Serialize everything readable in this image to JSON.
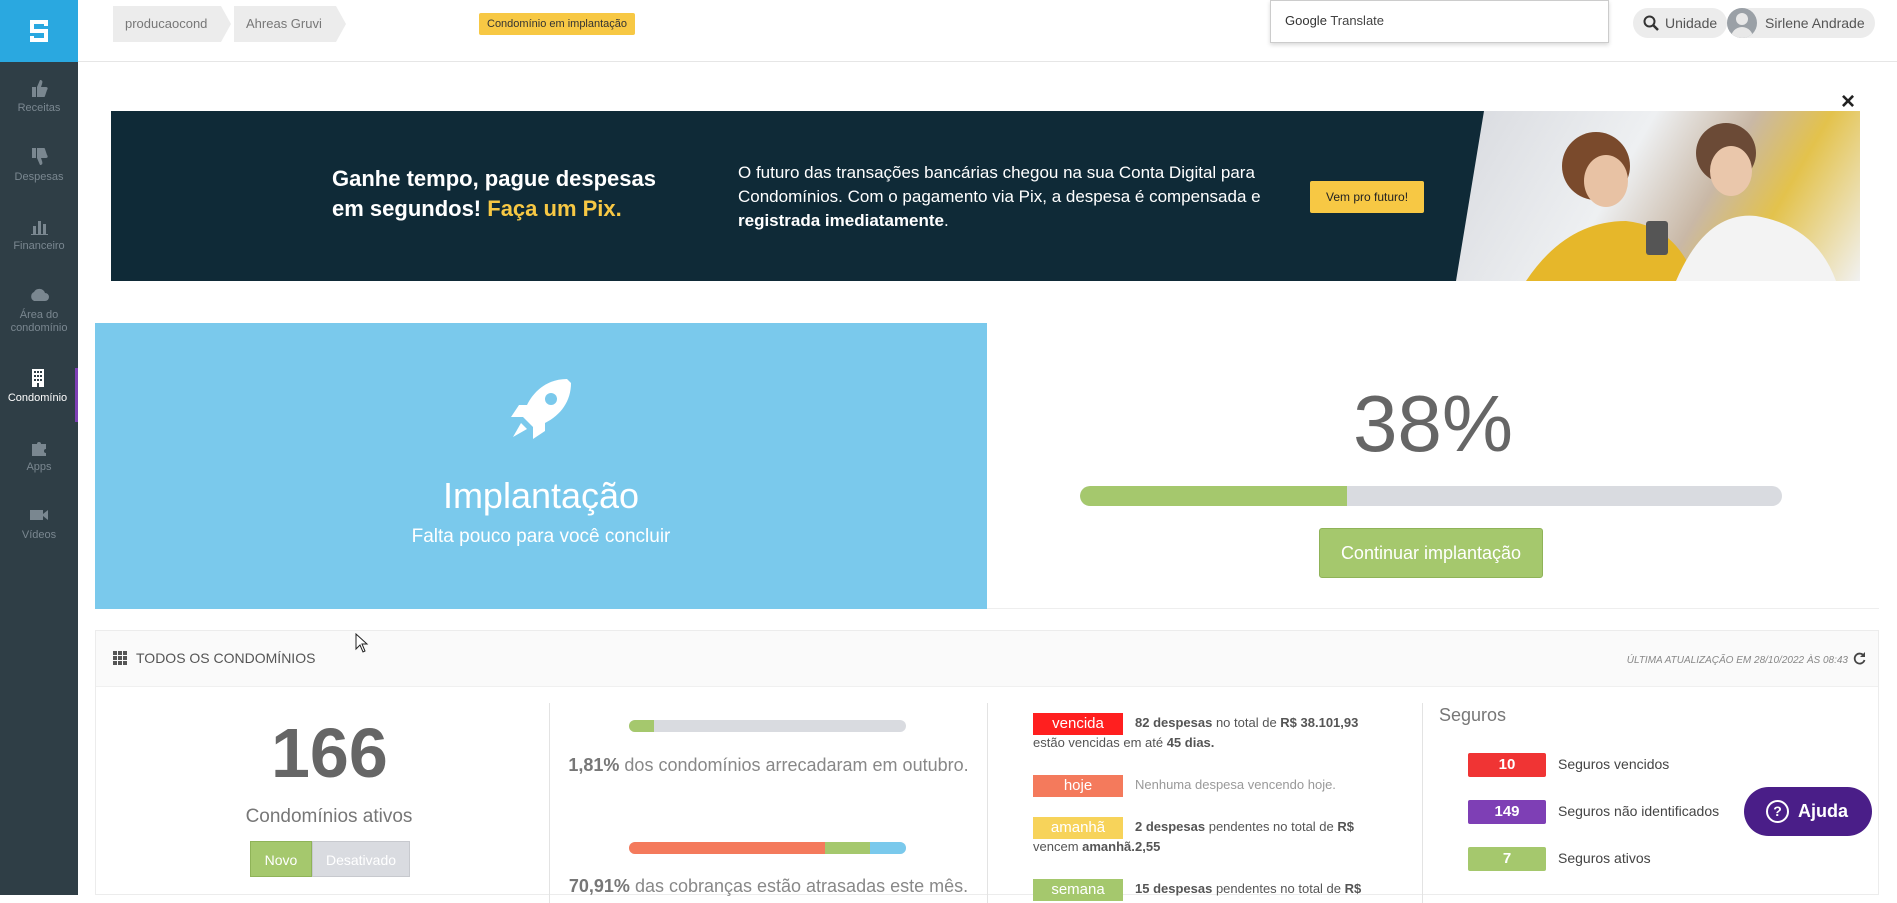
{
  "sidebar": {
    "items": [
      {
        "label": "Receitas",
        "icon": "thumbs-up-icon"
      },
      {
        "label": "Despesas",
        "icon": "thumbs-down-icon"
      },
      {
        "label": "Financeiro",
        "icon": "bar-chart-icon"
      },
      {
        "label": "Área do condomínio",
        "icon": "cloud-icon"
      },
      {
        "label": "Condomínio",
        "icon": "building-icon",
        "active": true
      },
      {
        "label": "Apps",
        "icon": "puzzle-icon"
      },
      {
        "label": "Vídeos",
        "icon": "video-camera-icon"
      }
    ]
  },
  "header": {
    "breadcrumbs": [
      "producaocond",
      "Ahreas Gruvi"
    ],
    "status_badge": "Condomínio em implantação",
    "google_translate": {
      "brand": "Google",
      "label": "Translate"
    },
    "search_label": "Unidade",
    "user_name": "Sirlene Andrade"
  },
  "banner": {
    "headline_part1": "Ganhe tempo, pague despesas em segundos! ",
    "headline_highlight": "Faça um Pix.",
    "body_part1": "O futuro das transações bancárias chegou na sua Conta Digital para Condomínios. Com o pagamento via Pix, a despesa é compensada e ",
    "body_bold": "registrada imediatamente",
    "body_end": ".",
    "cta": "Vem pro futuro!",
    "close_icon": "×"
  },
  "implantacao": {
    "title": "Implantação",
    "subtitle": "Falta pouco para você concluir",
    "percent_label": "38%",
    "progress_fraction": 0.38,
    "continue_button": "Continuar implantação"
  },
  "condominios": {
    "title": "TODOS OS CONDOMÍNIOS",
    "last_update": "ÚLTIMA ATUALIZAÇÃO EM 28/10/2022 ÀS 08:43",
    "active_count": "166",
    "active_label": "Condomínios ativos",
    "filter_new": "Novo",
    "filter_disabled": "Desativado",
    "collected_pct": "1,81%",
    "collected_text": " dos condomínios arrecadaram em outubro.",
    "collected_fraction": 0.0181,
    "late_pct": "70,91%",
    "late_text": " das cobranças estão atrasadas este mês.",
    "late_bar_segments": [
      0.7091,
      0.16,
      0.1309
    ],
    "due": [
      {
        "tag": "vencida",
        "color": "#ff1f1f",
        "count": "82 despesas",
        "mid": " no total de ",
        "amount": "R$ 38.101,93",
        "tail": " estão vencidas em até ",
        "when": "45 dias."
      },
      {
        "tag": "hoje",
        "color": "#f47a5c",
        "text": "Nenhuma despesa vencendo hoje."
      },
      {
        "tag": "amanhã",
        "color": "#f7d35a",
        "count": "2 despesas",
        "mid": " pendentes no total de ",
        "amount": "R$ 2,55",
        "tail": " vencem ",
        "when": "amanhã."
      },
      {
        "tag": "semana",
        "color": "#a5c86d",
        "count": "15 despesas",
        "mid": " pendentes no total de ",
        "amount": "R$",
        "tail": "",
        "when": ""
      }
    ]
  },
  "seguros": {
    "title": "Seguros",
    "rows": [
      {
        "count": "10",
        "label": "Seguros vencidos",
        "color": "#f03434"
      },
      {
        "count": "149",
        "label": "Seguros não identificados",
        "color": "#7e3fb5"
      },
      {
        "count": "7",
        "label": "Seguros ativos",
        "color": "#a5c86d"
      }
    ]
  },
  "help": {
    "label": "Ajuda",
    "icon": "?"
  }
}
